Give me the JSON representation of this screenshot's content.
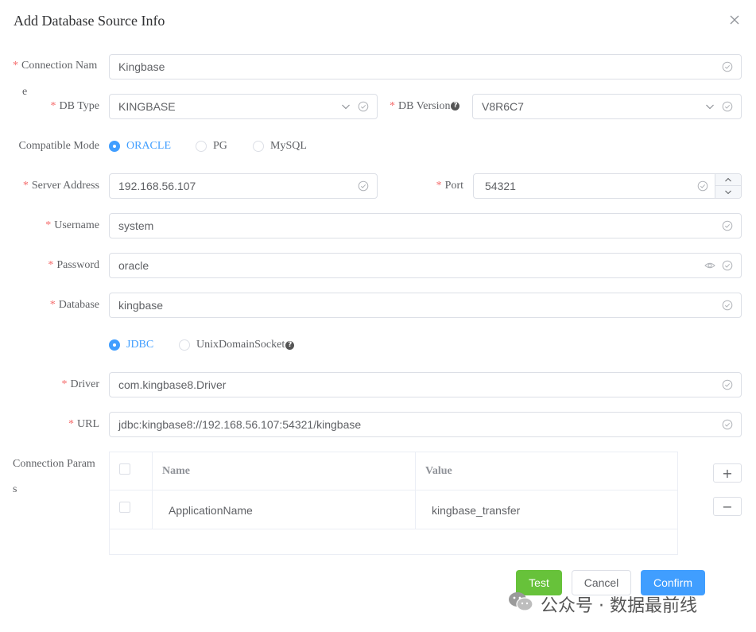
{
  "dialog": {
    "title": "Add Database Source Info",
    "close_icon": "close-icon"
  },
  "form": {
    "connection_name": {
      "label_line1": "Connection Nam",
      "label_line2": "e",
      "value": "Kingbase",
      "required": true
    },
    "db_type": {
      "label": "DB Type",
      "value": "KINGBASE",
      "required": true
    },
    "db_version": {
      "label": "DB Version",
      "value": "V8R6C7",
      "required": true,
      "help_icon": "question-icon"
    },
    "compatible_mode": {
      "label": "Compatible Mode",
      "options": [
        "ORACLE",
        "PG",
        "MySQL"
      ],
      "selected": "ORACLE"
    },
    "server_address": {
      "label": "Server Address",
      "value": "192.168.56.107",
      "required": true
    },
    "port": {
      "label": "Port",
      "value": "54321",
      "required": true
    },
    "username": {
      "label": "Username",
      "value": "system",
      "required": true
    },
    "password": {
      "label": "Password",
      "value": "oracle",
      "required": true
    },
    "database": {
      "label": "Database",
      "value": "kingbase",
      "required": true
    },
    "connect_type": {
      "options": [
        "JDBC",
        "UnixDomainSocket"
      ],
      "selected": "JDBC",
      "help_icon": "question-icon"
    },
    "driver": {
      "label": "Driver",
      "value": "com.kingbase8.Driver",
      "required": true
    },
    "url": {
      "label": "URL",
      "value": "jdbc:kingbase8://192.168.56.107:54321/kingbase",
      "required": true
    },
    "connection_params": {
      "label_line1": "Connection Param",
      "label_line2": "s",
      "columns": [
        "Name",
        "Value"
      ],
      "rows": [
        {
          "name": "ApplicationName",
          "value": "kingbase_transfer"
        }
      ],
      "add_symbol": "+",
      "remove_symbol": "−"
    }
  },
  "footer": {
    "test_label": "Test",
    "cancel_label": "Cancel",
    "confirm_label": "Confirm"
  },
  "watermark": {
    "text": "公众号 · 数据最前线",
    "icon": "wechat-icon"
  },
  "colors": {
    "primary": "#409eff",
    "success": "#67c23a",
    "required": "#f56c6c",
    "border": "#dcdfe6"
  }
}
